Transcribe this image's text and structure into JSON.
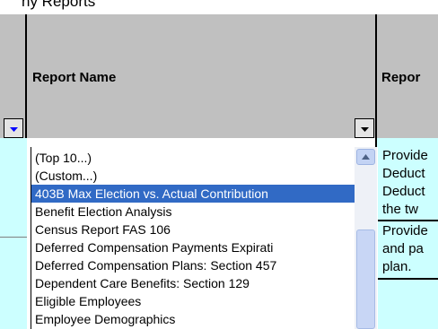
{
  "top_strip_text": "ny Reports",
  "headers": {
    "report_name": "Report Name",
    "report_desc": "Repor"
  },
  "dropdown": {
    "items": [
      "(Top 10...)",
      "(Custom...)",
      "403B Max Election vs. Actual Contribution",
      "Benefit Election Analysis",
      "Census Report FAS 106",
      "Deferred Compensation Payments Expirati",
      "Deferred Compensation Plans: Section 457",
      "Dependent Care Benefits: Section 129",
      "Eligible Employees",
      "Employee Demographics"
    ],
    "selected_index": 2
  },
  "descriptions": [
    "Provide",
    "Deduct",
    "Deduct",
    "the tw",
    "Provide",
    "and pa",
    "plan."
  ],
  "colors": {
    "header_bg": "#c0c0c0",
    "cell_bg": "#ccffff",
    "selection": "#316ac5",
    "filter_arrow_active": "#0000ff"
  }
}
